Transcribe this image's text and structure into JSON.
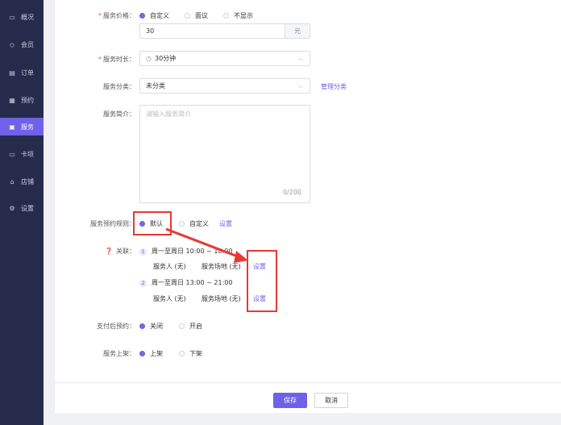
{
  "sidebar": {
    "items": [
      {
        "label": "概况",
        "icon": "monitor-icon",
        "active": false
      },
      {
        "label": "会员",
        "icon": "diamond-icon",
        "active": false
      },
      {
        "label": "订单",
        "icon": "list-icon",
        "active": false
      },
      {
        "label": "预约",
        "icon": "calendar-icon",
        "active": false
      },
      {
        "label": "服务",
        "icon": "service-icon",
        "active": true
      },
      {
        "label": "卡项",
        "icon": "card-icon",
        "active": false
      },
      {
        "label": "店铺",
        "icon": "store-icon",
        "active": false
      },
      {
        "label": "设置",
        "icon": "gear-icon",
        "active": false
      }
    ]
  },
  "form": {
    "price": {
      "label": "服务价格：",
      "options": [
        "自定义",
        "面议",
        "不显示"
      ],
      "selected": 0,
      "value": "30",
      "unit": "元"
    },
    "duration": {
      "label": "服务时长：",
      "value": "30分钟"
    },
    "category": {
      "label": "服务分类：",
      "value": "未分类",
      "manage_link": "管理分类"
    },
    "intro": {
      "label": "服务简介：",
      "placeholder": "请输入服务简介",
      "counter": "0/200"
    },
    "booking_rule": {
      "label": "服务预约规则：",
      "options": [
        "默认",
        "自定义"
      ],
      "selected": 0,
      "setup_link": "设置"
    },
    "related": {
      "label": "关联：",
      "items": [
        {
          "index": "1",
          "time": "周一至周日 10:00 ~ 18:00",
          "staff": "服务人 (无)",
          "venue": "服务场地 (无)",
          "setup": "设置"
        },
        {
          "index": "2",
          "time": "周一至周日 13:00 ~ 21:00",
          "staff": "服务人 (无)",
          "venue": "服务场地 (无)",
          "setup": "设置"
        }
      ]
    },
    "pay_booking": {
      "label": "支付后预约：",
      "options": [
        "关闭",
        "开启"
      ],
      "selected": 0
    },
    "listing": {
      "label": "服务上架：",
      "options": [
        "上架",
        "下架"
      ],
      "selected": 0
    }
  },
  "footer": {
    "save": "保存",
    "cancel": "取消"
  },
  "colors": {
    "accent": "#6f61e8",
    "sidebar": "#272b4b",
    "annotation": "#e53935"
  }
}
